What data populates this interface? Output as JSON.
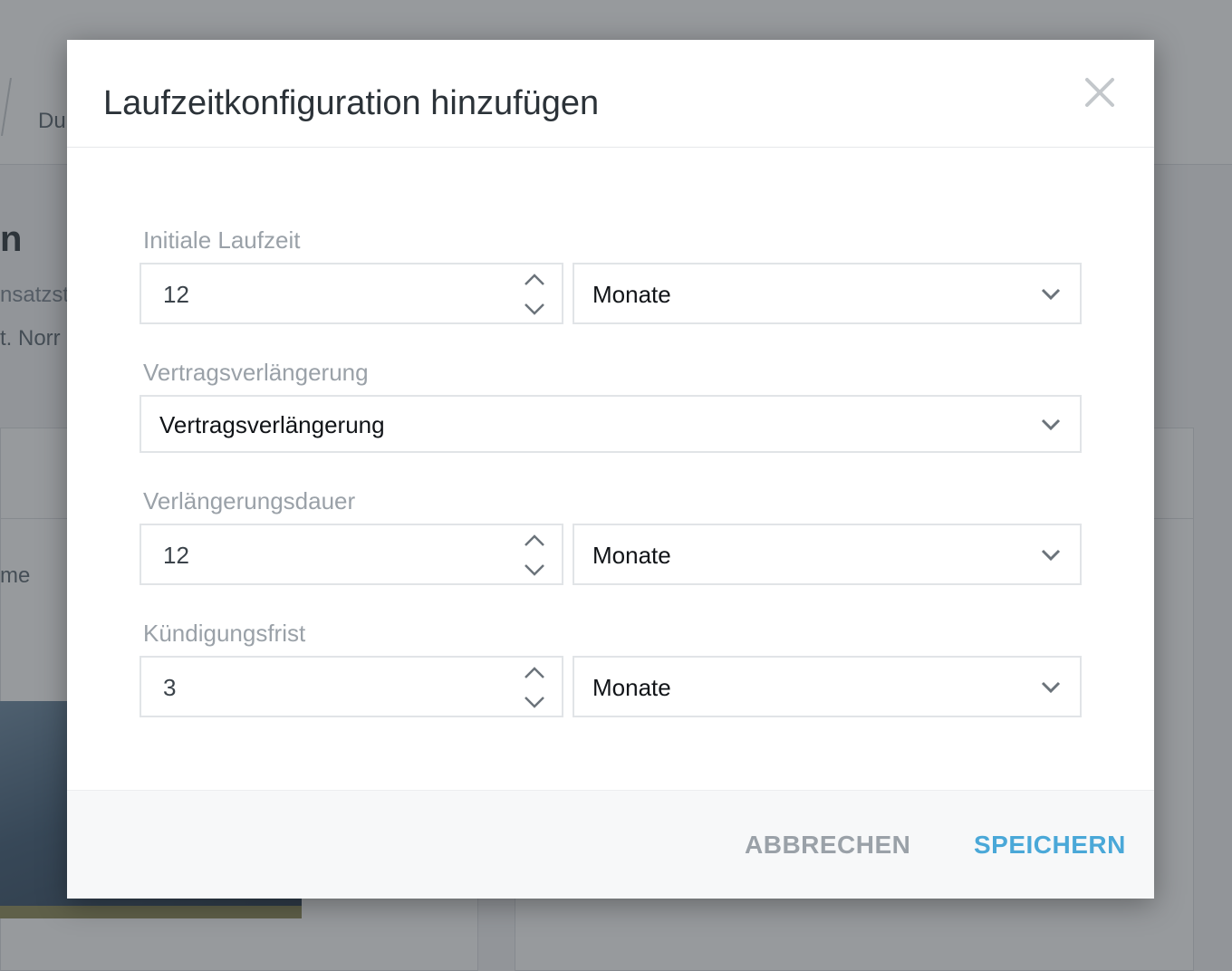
{
  "background": {
    "breadcrumb": "Du",
    "heading": "n",
    "subtitle_1": "nsatzst",
    "subtitle_2": "t. Norr",
    "name_label": "me"
  },
  "modal": {
    "title": "Laufzeitkonfiguration hinzufügen",
    "close_icon": "close-icon",
    "fields": {
      "initial_term": {
        "label": "Initiale Laufzeit",
        "value": "12",
        "unit": "Monate"
      },
      "contract_extension": {
        "label": "Vertragsverlängerung",
        "value": "Vertragsverlängerung"
      },
      "extension_duration": {
        "label": "Verlängerungsdauer",
        "value": "12",
        "unit": "Monate"
      },
      "notice_period": {
        "label": "Kündigungsfrist",
        "value": "3",
        "unit": "Monate"
      }
    },
    "footer": {
      "cancel_label": "ABBRECHEN",
      "save_label": "SPEICHERN"
    }
  },
  "colors": {
    "accent": "#4aa8d8",
    "label": "#9aa1a8",
    "title": "#2b3238"
  }
}
